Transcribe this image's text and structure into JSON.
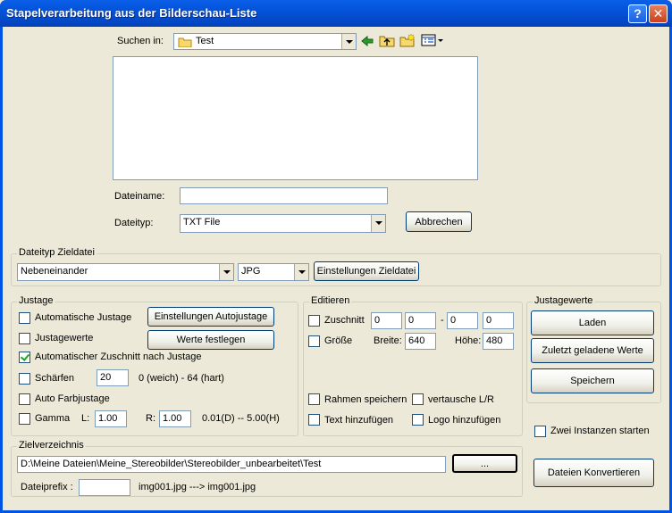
{
  "window": {
    "title": "Stapelverarbeitung aus der Bilderschau-Liste",
    "help_glyph": "?",
    "close_glyph": "✕"
  },
  "filepicker": {
    "search_label": "Suchen in:",
    "search_folder": "Test",
    "filename_label": "Dateiname:",
    "filename_value": "",
    "filetype_label": "Dateityp:",
    "filetype_value": "TXT File",
    "cancel_label": "Abbrechen"
  },
  "dateityp": {
    "title": "Dateityp Zieldatei",
    "layout_value": "Nebeneinander",
    "format_value": "JPG",
    "settings_label": "Einstellungen Zieldatei"
  },
  "justage": {
    "title": "Justage",
    "auto_label": "Automatische Justage",
    "auto_checked": false,
    "auto_settings_label": "Einstellungen Autojustage",
    "values_label": "Justagewerte",
    "values_checked": false,
    "values_set_label": "Werte festlegen",
    "autocrop_label": "Automatischer Zuschnitt nach Justage",
    "autocrop_checked": true,
    "sharpen_label": "Schärfen",
    "sharpen_checked": false,
    "sharpen_value": "20",
    "sharpen_range": "0 (weich) - 64 (hart)",
    "color_label": "Auto Farbjustage",
    "color_checked": false,
    "gamma_label": "Gamma",
    "gamma_checked": false,
    "gamma_l_label": "L:",
    "gamma_l_value": "1.00",
    "gamma_r_label": "R:",
    "gamma_r_value": "1.00",
    "gamma_range": "0.01(D) -- 5.00(H)"
  },
  "editieren": {
    "title": "Editieren",
    "crop_label": "Zuschnitt",
    "crop_checked": false,
    "crop_values": [
      "0",
      "0",
      "0",
      "0"
    ],
    "crop_dash": "-",
    "size_label": "Größe",
    "size_checked": false,
    "width_label": "Breite:",
    "width_value": "640",
    "height_label": "Höhe:",
    "height_value": "480",
    "frame_label": "Rahmen speichern",
    "frame_checked": false,
    "swap_label": "vertausche L/R",
    "swap_checked": false,
    "text_label": "Text hinzufügen",
    "text_checked": false,
    "logo_label": "Logo hinzufügen",
    "logo_checked": false
  },
  "justagewerte": {
    "title": "Justagewerte",
    "load_label": "Laden",
    "last_label": "Zuletzt geladene Werte",
    "save_label": "Speichern"
  },
  "instances": {
    "label": "Zwei Instanzen starten",
    "checked": false
  },
  "zielverzeichnis": {
    "title": "Zielverzeichnis",
    "path_value": "D:\\Meine Dateien\\Meine_Stereobilder\\Stereobilder_unbearbeitet\\Test",
    "browse_label": "...",
    "prefix_label": "Dateiprefix :",
    "prefix_value": "",
    "example": "img001.jpg ---> img001.jpg"
  },
  "convert_label": "Dateien Konvertieren",
  "colors": {
    "titlebar": "#0054e3",
    "face": "#ece9d8",
    "border": "#7f9db9",
    "check": "#21a121"
  }
}
